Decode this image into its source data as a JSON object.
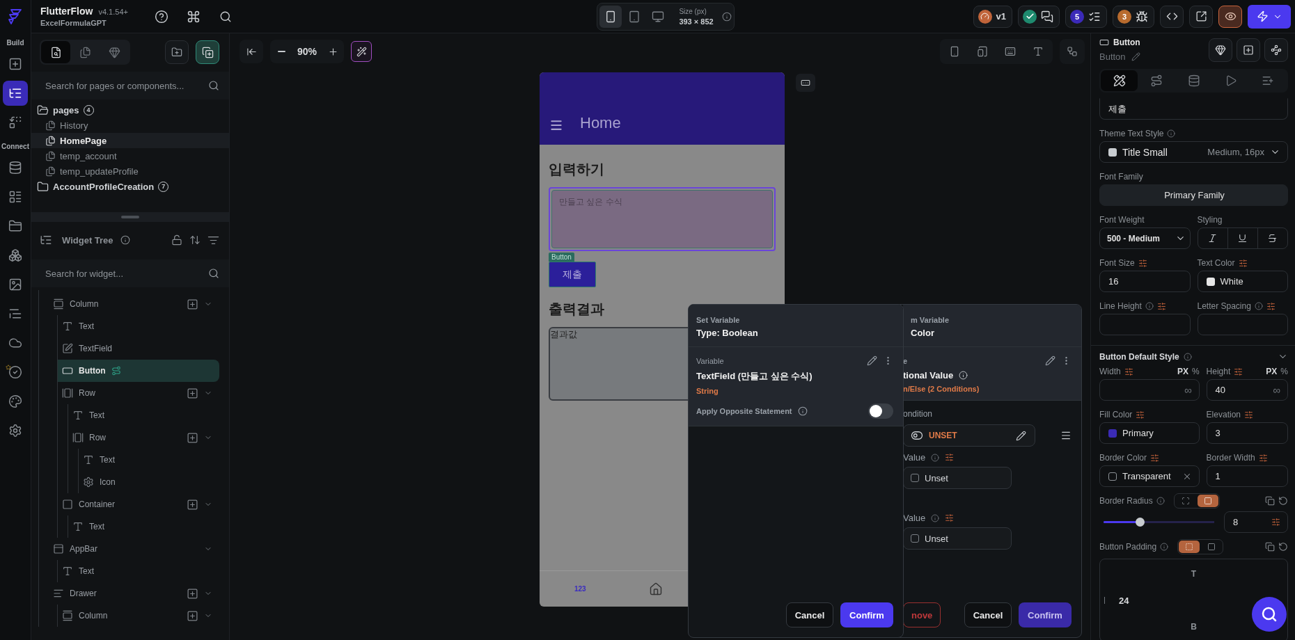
{
  "app": {
    "name": "FlutterFlow",
    "version": "v4.1.54+",
    "project": "ExcelFormulaGPT"
  },
  "rail": {
    "build_label": "Build",
    "build_items": [
      {
        "selected": false
      },
      {
        "selected": true
      },
      {
        "selected": false
      }
    ],
    "connect_label": "Connect",
    "connect_items": [
      {
        "selected": false
      },
      {
        "selected": false
      },
      {
        "selected": false
      },
      {
        "selected": false
      },
      {
        "selected": false
      },
      {
        "selected": false
      },
      {
        "selected": false
      },
      {
        "selected": false
      },
      {
        "selected": false
      },
      {
        "selected": false
      }
    ]
  },
  "device_bar": {
    "devices": [
      {
        "selected": true
      },
      {
        "selected": false
      },
      {
        "selected": false
      }
    ],
    "size_label": "Size (px)",
    "size": "393 × 852"
  },
  "status_badges": [
    {
      "kind": "version",
      "label": "v1"
    },
    {
      "kind": "check"
    },
    {
      "kind": "issues",
      "label": "5"
    },
    {
      "kind": "bugs",
      "label": "3"
    }
  ],
  "preview_active": true,
  "page_panel": {
    "tabs": [
      {
        "selected": true
      },
      {
        "selected": false
      },
      {
        "selected": false
      }
    ],
    "search_placeholder": "Search for pages or components...",
    "folders": [
      {
        "name": "pages",
        "count": "4",
        "expanded": true,
        "pages": [
          {
            "name": "History",
            "selected": false
          },
          {
            "name": "HomePage",
            "selected": true
          },
          {
            "name": "temp_account",
            "selected": false
          },
          {
            "name": "temp_updateProfile",
            "selected": false
          }
        ]
      },
      {
        "name": "AccountProfileCreation",
        "count": "7",
        "expanded": false
      }
    ]
  },
  "widget_tree": {
    "title": "Widget Tree",
    "search_placeholder": "Search for widget...",
    "nodes": [
      {
        "name": "Column",
        "kind": "column",
        "selected": false,
        "add_button": true,
        "children": [
          {
            "name": "Text",
            "kind": "text",
            "selected": false
          },
          {
            "name": "TextField",
            "kind": "textfield",
            "selected": false
          },
          {
            "name": "Button",
            "kind": "button",
            "selected": true,
            "has_action": true
          },
          {
            "name": "Row",
            "kind": "row",
            "selected": false,
            "add_button": true,
            "children": [
              {
                "name": "Text",
                "kind": "text",
                "selected": false
              },
              {
                "name": "Row",
                "kind": "row",
                "selected": false,
                "add_button": true,
                "children": [
                  {
                    "name": "Text",
                    "kind": "text",
                    "selected": false
                  },
                  {
                    "name": "Icon",
                    "kind": "icon",
                    "selected": false
                  }
                ]
              }
            ]
          },
          {
            "name": "Container",
            "kind": "container",
            "selected": false,
            "add_button": true,
            "children": [
              {
                "name": "Text",
                "kind": "text",
                "selected": false
              }
            ]
          }
        ]
      },
      {
        "name": "AppBar",
        "kind": "appbar",
        "selected": false,
        "add_button": false,
        "children": [
          {
            "name": "Text",
            "kind": "text",
            "selected": false
          }
        ]
      },
      {
        "name": "Drawer",
        "kind": "drawer",
        "selected": false,
        "add_button": true,
        "children": [
          {
            "name": "Column",
            "kind": "column",
            "selected": false,
            "add_button": true
          }
        ]
      }
    ]
  },
  "canvas": {
    "zoom": "90%"
  },
  "phone": {
    "appbar_title": "Home",
    "input_heading": "입력하기",
    "input_placeholder": "만들고 싶은 수식",
    "selection_tag": "Button",
    "button_label": "제출",
    "output_heading": "출력결과",
    "output_value": "결과값",
    "nav_label": "123"
  },
  "back_dialog": {
    "header_label": "m Variable",
    "title": "Color",
    "section_label": "e",
    "value_title": "tional Value",
    "value_detail": "n/Else (2 Conditions)",
    "condition_label": "ondition",
    "condition_value": "UNSET",
    "cases": [
      {
        "label": "Value",
        "value": "Unset"
      },
      {
        "label": "Value",
        "value": "Unset"
      }
    ],
    "buttons": [
      {
        "label": "nove",
        "kind": "danger"
      },
      {
        "label": "Cancel",
        "kind": "secondary"
      },
      {
        "label": "Confirm",
        "kind": "primary"
      }
    ]
  },
  "front_dialog": {
    "header_label": "Set Variable",
    "title": "Type: Boolean",
    "section_label": "Variable",
    "variable": "TextField (만들고 싶은 수식)",
    "variable_type": "String",
    "option_label": "Apply Opposite Statement",
    "option_on": false,
    "buttons": [
      {
        "label": "Cancel",
        "kind": "secondary"
      },
      {
        "label": "Confirm",
        "kind": "primary"
      }
    ]
  },
  "inspector": {
    "widget_type": "Button",
    "widget_name": "Button",
    "tabs": [
      {
        "selected": true
      },
      {
        "selected": false
      },
      {
        "selected": false
      },
      {
        "selected": false
      },
      {
        "selected": false
      }
    ],
    "text_value": "제출",
    "theme_text_style": {
      "label": "Theme Text Style",
      "value": "Title Small",
      "detail": "Medium, 16px"
    },
    "font_family": {
      "label": "Font Family",
      "value": "Primary Family"
    },
    "font_weight": {
      "label": "Font Weight",
      "value": "500 - Medium"
    },
    "styling_label": "Styling",
    "text_fields": [
      {
        "label": "Font Size",
        "kind": "text",
        "info": false,
        "value": "16"
      },
      {
        "label": "Text Color",
        "kind": "color",
        "info": false,
        "value": "White",
        "color": "#e6e6e6"
      },
      {
        "label": "Line Height",
        "kind": "text",
        "info": true
      },
      {
        "label": "Letter Spacing",
        "kind": "text",
        "info": true
      }
    ],
    "section_title": "Button Default Style",
    "style_fields": [
      {
        "label": "Width",
        "kind": "size",
        "info": false,
        "units": [
          "PX",
          "%"
        ],
        "suffix": "∞"
      },
      {
        "label": "Height",
        "kind": "size",
        "info": false,
        "units": [
          "PX",
          "%"
        ],
        "value": "40",
        "suffix": "∞"
      },
      {
        "label": "Fill Color",
        "kind": "color",
        "info": false,
        "value": "Primary",
        "color": "#3b2bb5"
      },
      {
        "label": "Elevation",
        "kind": "text",
        "info": false,
        "value": "3"
      },
      {
        "label": "Border Color",
        "kind": "clearable",
        "info": false,
        "value": "Transparent"
      },
      {
        "label": "Border Width",
        "kind": "text",
        "info": false,
        "value": "1"
      }
    ],
    "border_radius": {
      "label": "Border Radius",
      "level": 0.33,
      "value": "8"
    },
    "padding": {
      "label": "Button Padding",
      "top": "T",
      "value": "24",
      "bottom": "B"
    }
  }
}
